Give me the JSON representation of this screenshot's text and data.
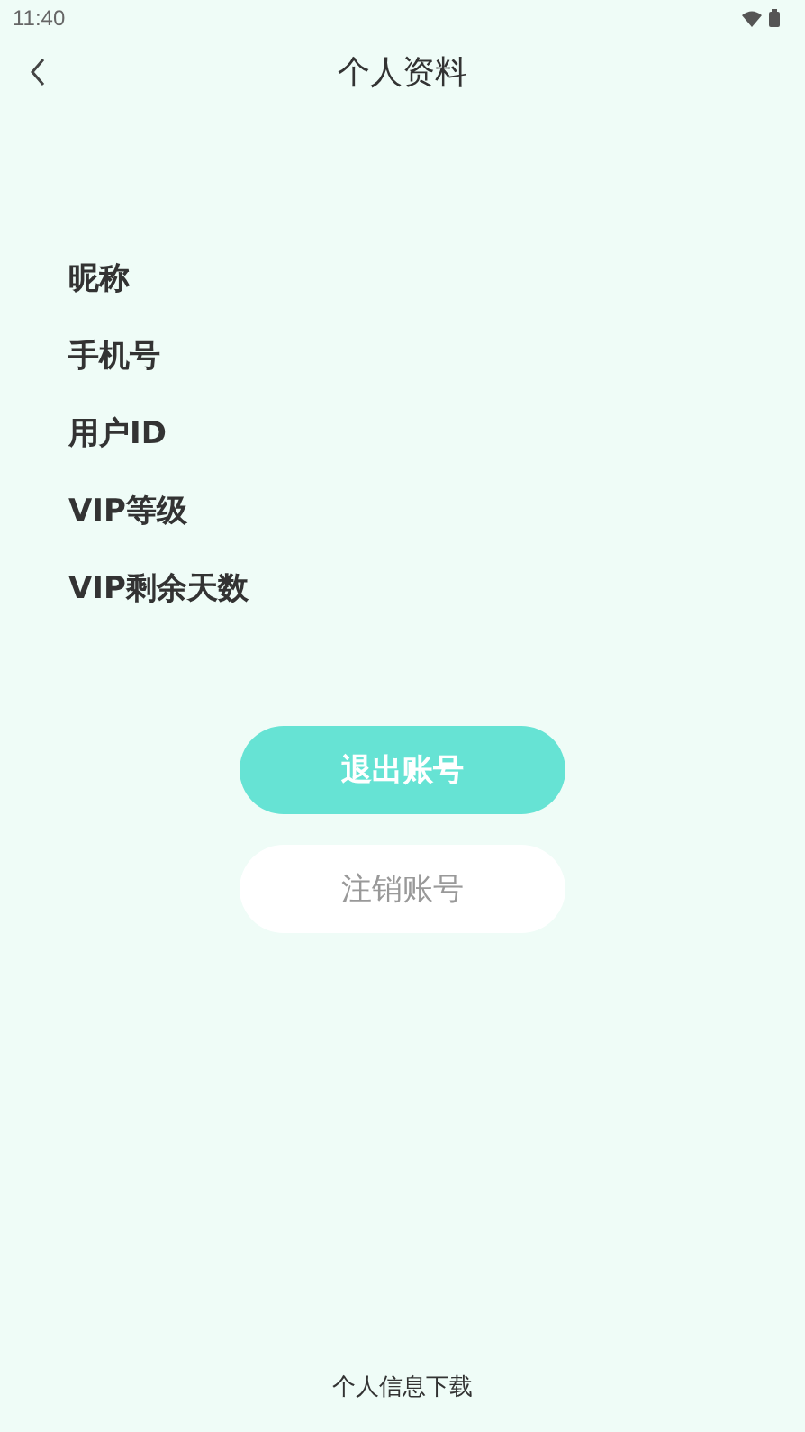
{
  "status_bar": {
    "time": "11:40"
  },
  "header": {
    "title": "个人资料"
  },
  "fields": [
    {
      "label": "昵称"
    },
    {
      "label": "手机号"
    },
    {
      "label": "用户ID"
    },
    {
      "label": "VIP等级"
    },
    {
      "label": "VIP剩余天数"
    }
  ],
  "buttons": [
    {
      "label": "退出账号",
      "kind": "primary"
    },
    {
      "label": "注销账号",
      "kind": "secondary"
    }
  ],
  "footer_link": "个人信息下载"
}
